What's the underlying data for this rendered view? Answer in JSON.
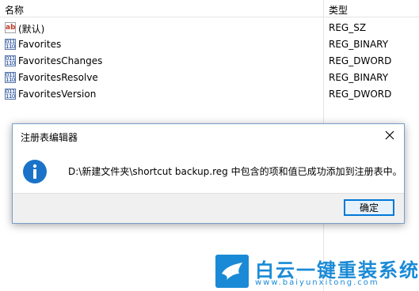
{
  "list": {
    "header": {
      "name": "名称",
      "type": "类型"
    },
    "rows": [
      {
        "name": "(默认)",
        "type": "REG_SZ",
        "icon": "string-value-icon"
      },
      {
        "name": "Favorites",
        "type": "REG_BINARY",
        "icon": "binary-value-icon"
      },
      {
        "name": "FavoritesChanges",
        "type": "REG_DWORD",
        "icon": "binary-value-icon"
      },
      {
        "name": "FavoritesResolve",
        "type": "REG_BINARY",
        "icon": "binary-value-icon"
      },
      {
        "name": "FavoritesVersion",
        "type": "REG_DWORD",
        "icon": "binary-value-icon"
      }
    ]
  },
  "dialog": {
    "title": "注册表编辑器",
    "message": "D:\\新建文件夹\\shortcut backup.reg 中包含的项和值已成功添加到注册表中。",
    "ok_label": "确定",
    "accent_color": "#0078d7",
    "info_icon_color": "#1a73c8"
  },
  "watermark": {
    "text": "白云一键重装系统",
    "url": "www.baiyunxitong.com",
    "color": "#1a8ad6"
  }
}
